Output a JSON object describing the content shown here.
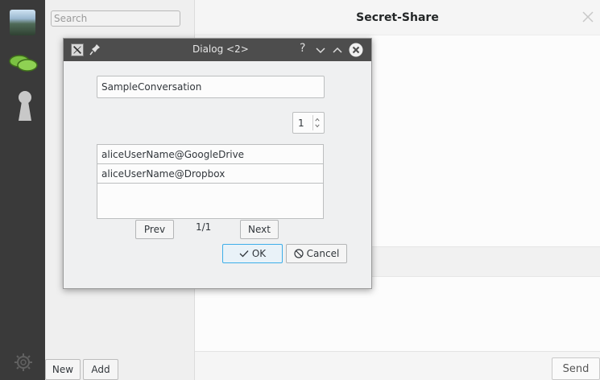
{
  "app": {
    "window_title": "Secret-Share"
  },
  "sidebar": {
    "icons": [
      "avatar-image",
      "chat-bubbles-icon",
      "keyhole-icon",
      "gear-icon"
    ]
  },
  "list_panel": {
    "search_placeholder": "Search",
    "new_label": "New",
    "add_label": "Add"
  },
  "composer": {
    "send_label": "Send"
  },
  "dialog": {
    "title": "Dialog <2>",
    "help_label": "?",
    "name_value": "SampleConversation",
    "spin_value": "1",
    "accounts": [
      "aliceUserName@GoogleDrive",
      "aliceUserName@Dropbox"
    ],
    "prev_label": "Prev",
    "page_indicator": "1/1",
    "next_label": "Next",
    "ok_label": "OK",
    "cancel_label": "Cancel"
  },
  "colors": {
    "rail": "#3a3a3a",
    "titlebar": "#4d4d4d",
    "accent": "#3daee9",
    "chat_icon": "#7bc142"
  }
}
